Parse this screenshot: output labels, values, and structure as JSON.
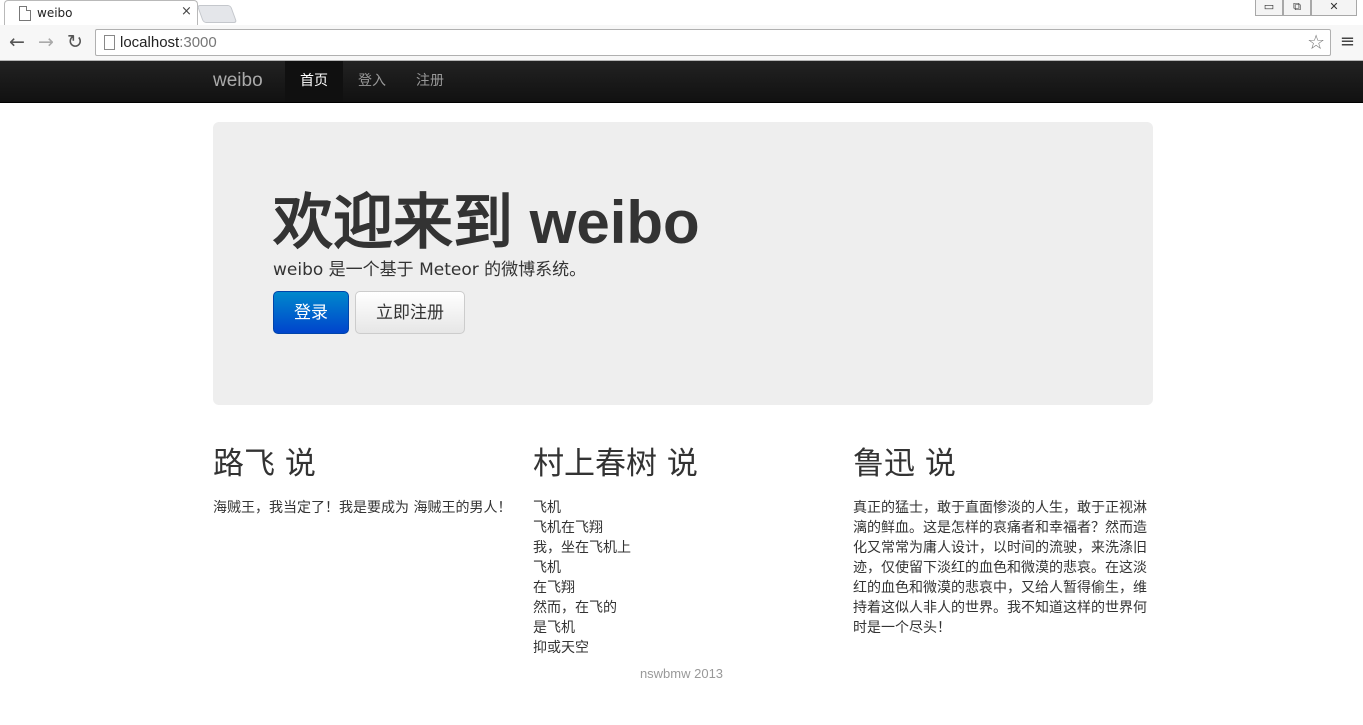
{
  "browser": {
    "tab_title": "weibo",
    "tab_close": "×",
    "url_host": "localhost",
    "url_port": ":3000",
    "back": "←",
    "forward": "→",
    "reload": "↻",
    "star": "☆",
    "menu": "≡",
    "window_controls": {
      "minimize": "▭",
      "restore": "⧉",
      "close": "✕"
    }
  },
  "navbar": {
    "brand": "weibo",
    "items": [
      {
        "label": "首页",
        "active": true
      },
      {
        "label": "登入",
        "active": false
      },
      {
        "label": "注册",
        "active": false
      }
    ]
  },
  "hero": {
    "title": "欢迎来到 weibo",
    "subtitle": "weibo 是一个基于 Meteor 的微博系统。",
    "login_button": "登录",
    "register_button": "立即注册"
  },
  "columns": [
    {
      "heading": "路飞 说",
      "lines": [
        "海贼王，我当定了！我是要成为 海贼王的男人！"
      ]
    },
    {
      "heading": "村上春树 说",
      "lines": [
        "飞机",
        "飞机在飞翔",
        "我，坐在飞机上",
        "飞机",
        "在飞翔",
        "然而，在飞的",
        "是飞机",
        "抑或天空"
      ]
    },
    {
      "heading": "鲁迅 说",
      "lines": [
        "真正的猛士，敢于直面惨淡的人生，敢于正视淋",
        "漓的鲜血。这是怎样的哀痛者和幸福者？然而造",
        "化又常常为庸人设计，以时间的流驶，来洗涤旧",
        "迹，仅使留下淡红的血色和微漠的悲哀。在这淡",
        "红的血色和微漠的悲哀中，又给人暂得偷生，维",
        "持着这似人非人的世界。我不知道这样的世界何",
        "时是一个尽头！"
      ]
    }
  ],
  "footer": {
    "text": "nswbmw 2013"
  }
}
